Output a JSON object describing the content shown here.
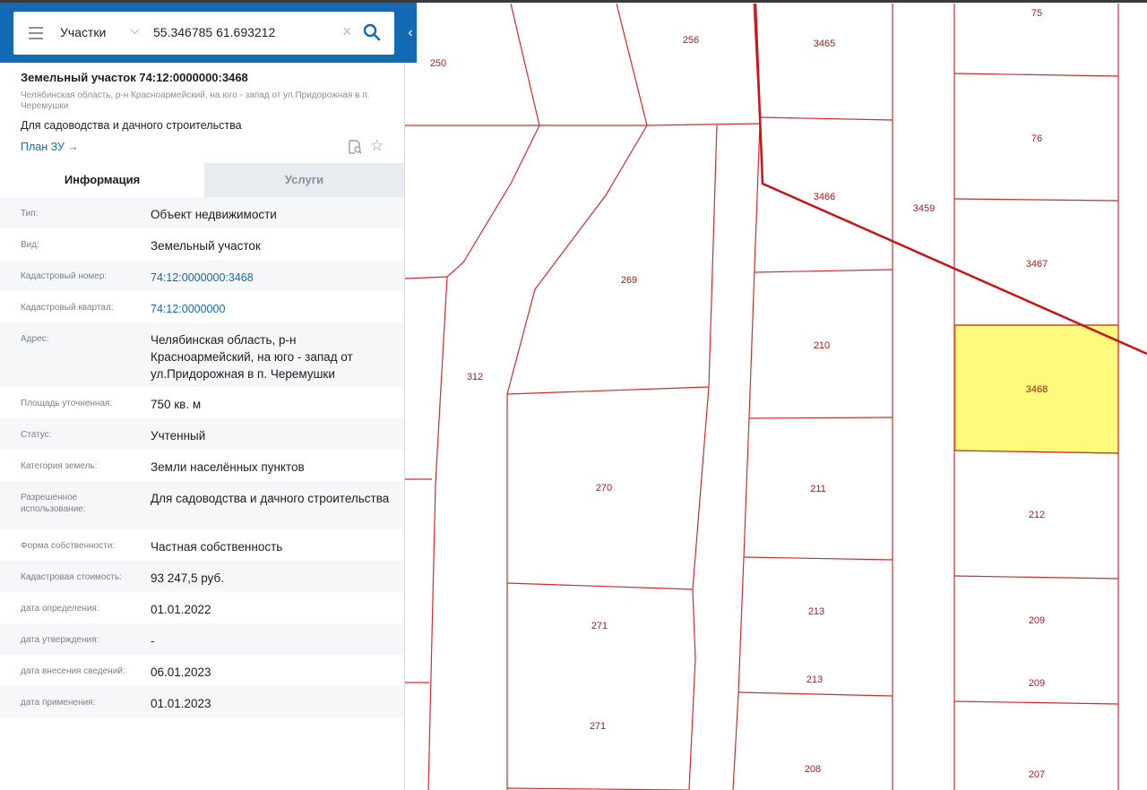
{
  "search": {
    "layer": "Участки",
    "query": "55.346785 61.693212"
  },
  "card": {
    "title": "Земельный участок 74:12:0000000:3468",
    "address_short": "Челябинская область, р-н Красноармейский, на юго - запад от ул.Придорожная в п. Черемушки",
    "purpose": "Для садоводства и дачного строительства",
    "plan_link": "План ЗУ →"
  },
  "tabs": {
    "info": "Информация",
    "services": "Услуги"
  },
  "rows": [
    {
      "label": "Тип:",
      "value": "Объект недвижимости"
    },
    {
      "label": "Вид:",
      "value": "Земельный участок"
    },
    {
      "label": "Кадастровый номер:",
      "value": "74:12:0000000:3468"
    },
    {
      "label": "Кадастровый квартал:",
      "value": "74:12:0000000"
    },
    {
      "label": "Адрес:",
      "value": "Челябинская область, р-н Красноармейский, на юго - запад от ул.Придорожная в п. Черемушки"
    },
    {
      "label": "Площадь уточненная:",
      "value": "750 кв. м"
    },
    {
      "label": "Статус:",
      "value": "Учтенный"
    },
    {
      "label": "Категория земель:",
      "value": "Земли населённых пунктов"
    },
    {
      "label": "Разрешенное использование:",
      "value": "Для садоводства и дачного строительства"
    },
    {
      "label": "Форма собственности:",
      "value": "Частная собственность"
    },
    {
      "label": "Кадастровая стоимость:",
      "value": "93 247,5 руб."
    },
    {
      "label": "дата определения:",
      "value": "01.01.2022"
    },
    {
      "label": "дата утверждения:",
      "value": "-"
    },
    {
      "label": "дата внесения сведений:",
      "value": "06.01.2023"
    },
    {
      "label": "дата применения:",
      "value": "01.01.2023"
    }
  ],
  "map": {
    "plot_labels": [
      "250",
      "256",
      "3465",
      "75",
      "76",
      "3466",
      "3459",
      "3467",
      "269",
      "312",
      "210",
      "3468",
      "270",
      "211",
      "212",
      "271",
      "213",
      "209",
      "213",
      "209",
      "271",
      "208",
      "207"
    ],
    "selected_plot": "3468",
    "colors": {
      "boundary": "#d42a2a",
      "selected_fill": "#fdfa7c",
      "road": "#c81414",
      "panel_blue": "#1469b4"
    }
  }
}
